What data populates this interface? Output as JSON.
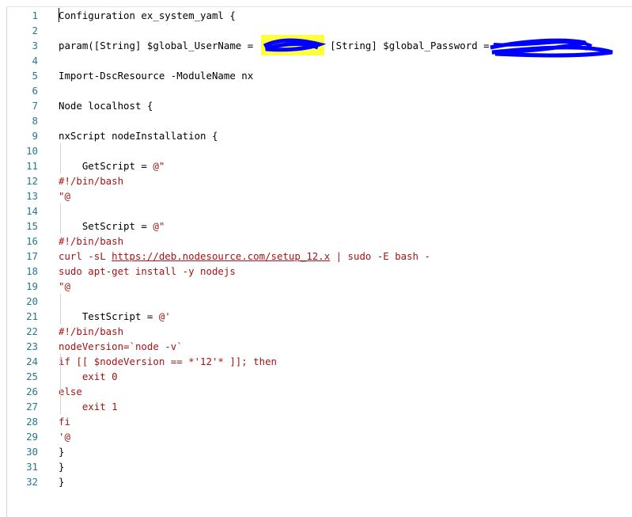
{
  "editor": {
    "lines": [
      {
        "n": "1",
        "segments": [
          {
            "t": "Configuration ex_system_yaml {",
            "c": "plain"
          }
        ]
      },
      {
        "n": "2",
        "segments": []
      },
      {
        "n": "3",
        "segments": [
          {
            "t": "param([String] $global_UserName = ",
            "c": "plain"
          },
          {
            "t": "            ",
            "c": "plain"
          },
          {
            "t": "[String] $global_Password = ",
            "c": "plain"
          },
          {
            "t": "              ",
            "c": "plain"
          },
          {
            "t": "')",
            "c": "plain"
          }
        ]
      },
      {
        "n": "4",
        "segments": []
      },
      {
        "n": "5",
        "segments": [
          {
            "t": "Import-DscResource -ModuleName nx",
            "c": "plain"
          }
        ]
      },
      {
        "n": "6",
        "segments": []
      },
      {
        "n": "7",
        "segments": [
          {
            "t": "Node localhost {",
            "c": "plain"
          }
        ]
      },
      {
        "n": "8",
        "segments": []
      },
      {
        "n": "9",
        "segments": [
          {
            "t": "nxScript nodeInstallation {",
            "c": "plain"
          }
        ]
      },
      {
        "n": "10",
        "segments": []
      },
      {
        "n": "11",
        "segments": [
          {
            "t": "    GetScript = ",
            "c": "plain"
          },
          {
            "t": "@\"",
            "c": "str"
          }
        ]
      },
      {
        "n": "12",
        "segments": [
          {
            "t": "#!/bin/bash",
            "c": "str"
          }
        ]
      },
      {
        "n": "13",
        "segments": [
          {
            "t": "\"@",
            "c": "str"
          }
        ]
      },
      {
        "n": "14",
        "segments": []
      },
      {
        "n": "15",
        "segments": [
          {
            "t": "    SetScript = ",
            "c": "plain"
          },
          {
            "t": "@\"",
            "c": "str"
          }
        ]
      },
      {
        "n": "16",
        "segments": [
          {
            "t": "#!/bin/bash",
            "c": "str"
          }
        ]
      },
      {
        "n": "17",
        "segments": [
          {
            "t": "curl -sL ",
            "c": "str"
          },
          {
            "t": "https://deb.nodesource.com/setup_12.x",
            "c": "url"
          },
          {
            "t": " | sudo -E bash -",
            "c": "str"
          }
        ]
      },
      {
        "n": "18",
        "segments": [
          {
            "t": "sudo apt-get install -y nodejs",
            "c": "str"
          }
        ]
      },
      {
        "n": "19",
        "segments": [
          {
            "t": "\"@",
            "c": "str"
          }
        ]
      },
      {
        "n": "20",
        "segments": []
      },
      {
        "n": "21",
        "segments": [
          {
            "t": "    TestScript = ",
            "c": "plain"
          },
          {
            "t": "@'",
            "c": "str"
          }
        ]
      },
      {
        "n": "22",
        "segments": [
          {
            "t": "#!/bin/bash",
            "c": "str"
          }
        ]
      },
      {
        "n": "23",
        "segments": [
          {
            "t": "nodeVersion=`node -v`",
            "c": "str"
          }
        ]
      },
      {
        "n": "24",
        "segments": [
          {
            "t": "if [[ $nodeVersion == *'12'* ]]; then",
            "c": "str"
          }
        ]
      },
      {
        "n": "25",
        "segments": [
          {
            "t": "    exit 0",
            "c": "str"
          }
        ]
      },
      {
        "n": "26",
        "segments": [
          {
            "t": "else",
            "c": "str"
          }
        ]
      },
      {
        "n": "27",
        "segments": [
          {
            "t": "    exit 1",
            "c": "str"
          }
        ]
      },
      {
        "n": "28",
        "segments": [
          {
            "t": "fi",
            "c": "str"
          }
        ]
      },
      {
        "n": "29",
        "segments": [
          {
            "t": "'@",
            "c": "str"
          }
        ]
      },
      {
        "n": "30",
        "segments": [
          {
            "t": "}",
            "c": "plain"
          }
        ]
      },
      {
        "n": "31",
        "segments": [
          {
            "t": "}",
            "c": "plain"
          }
        ]
      },
      {
        "n": "32",
        "segments": [
          {
            "t": "}",
            "c": "plain"
          }
        ]
      }
    ]
  },
  "colors": {
    "line_number": "#237893",
    "code_text": "#000000",
    "string_text": "#a31515",
    "highlight": "#ffff3c",
    "redaction": "#0000ff"
  }
}
